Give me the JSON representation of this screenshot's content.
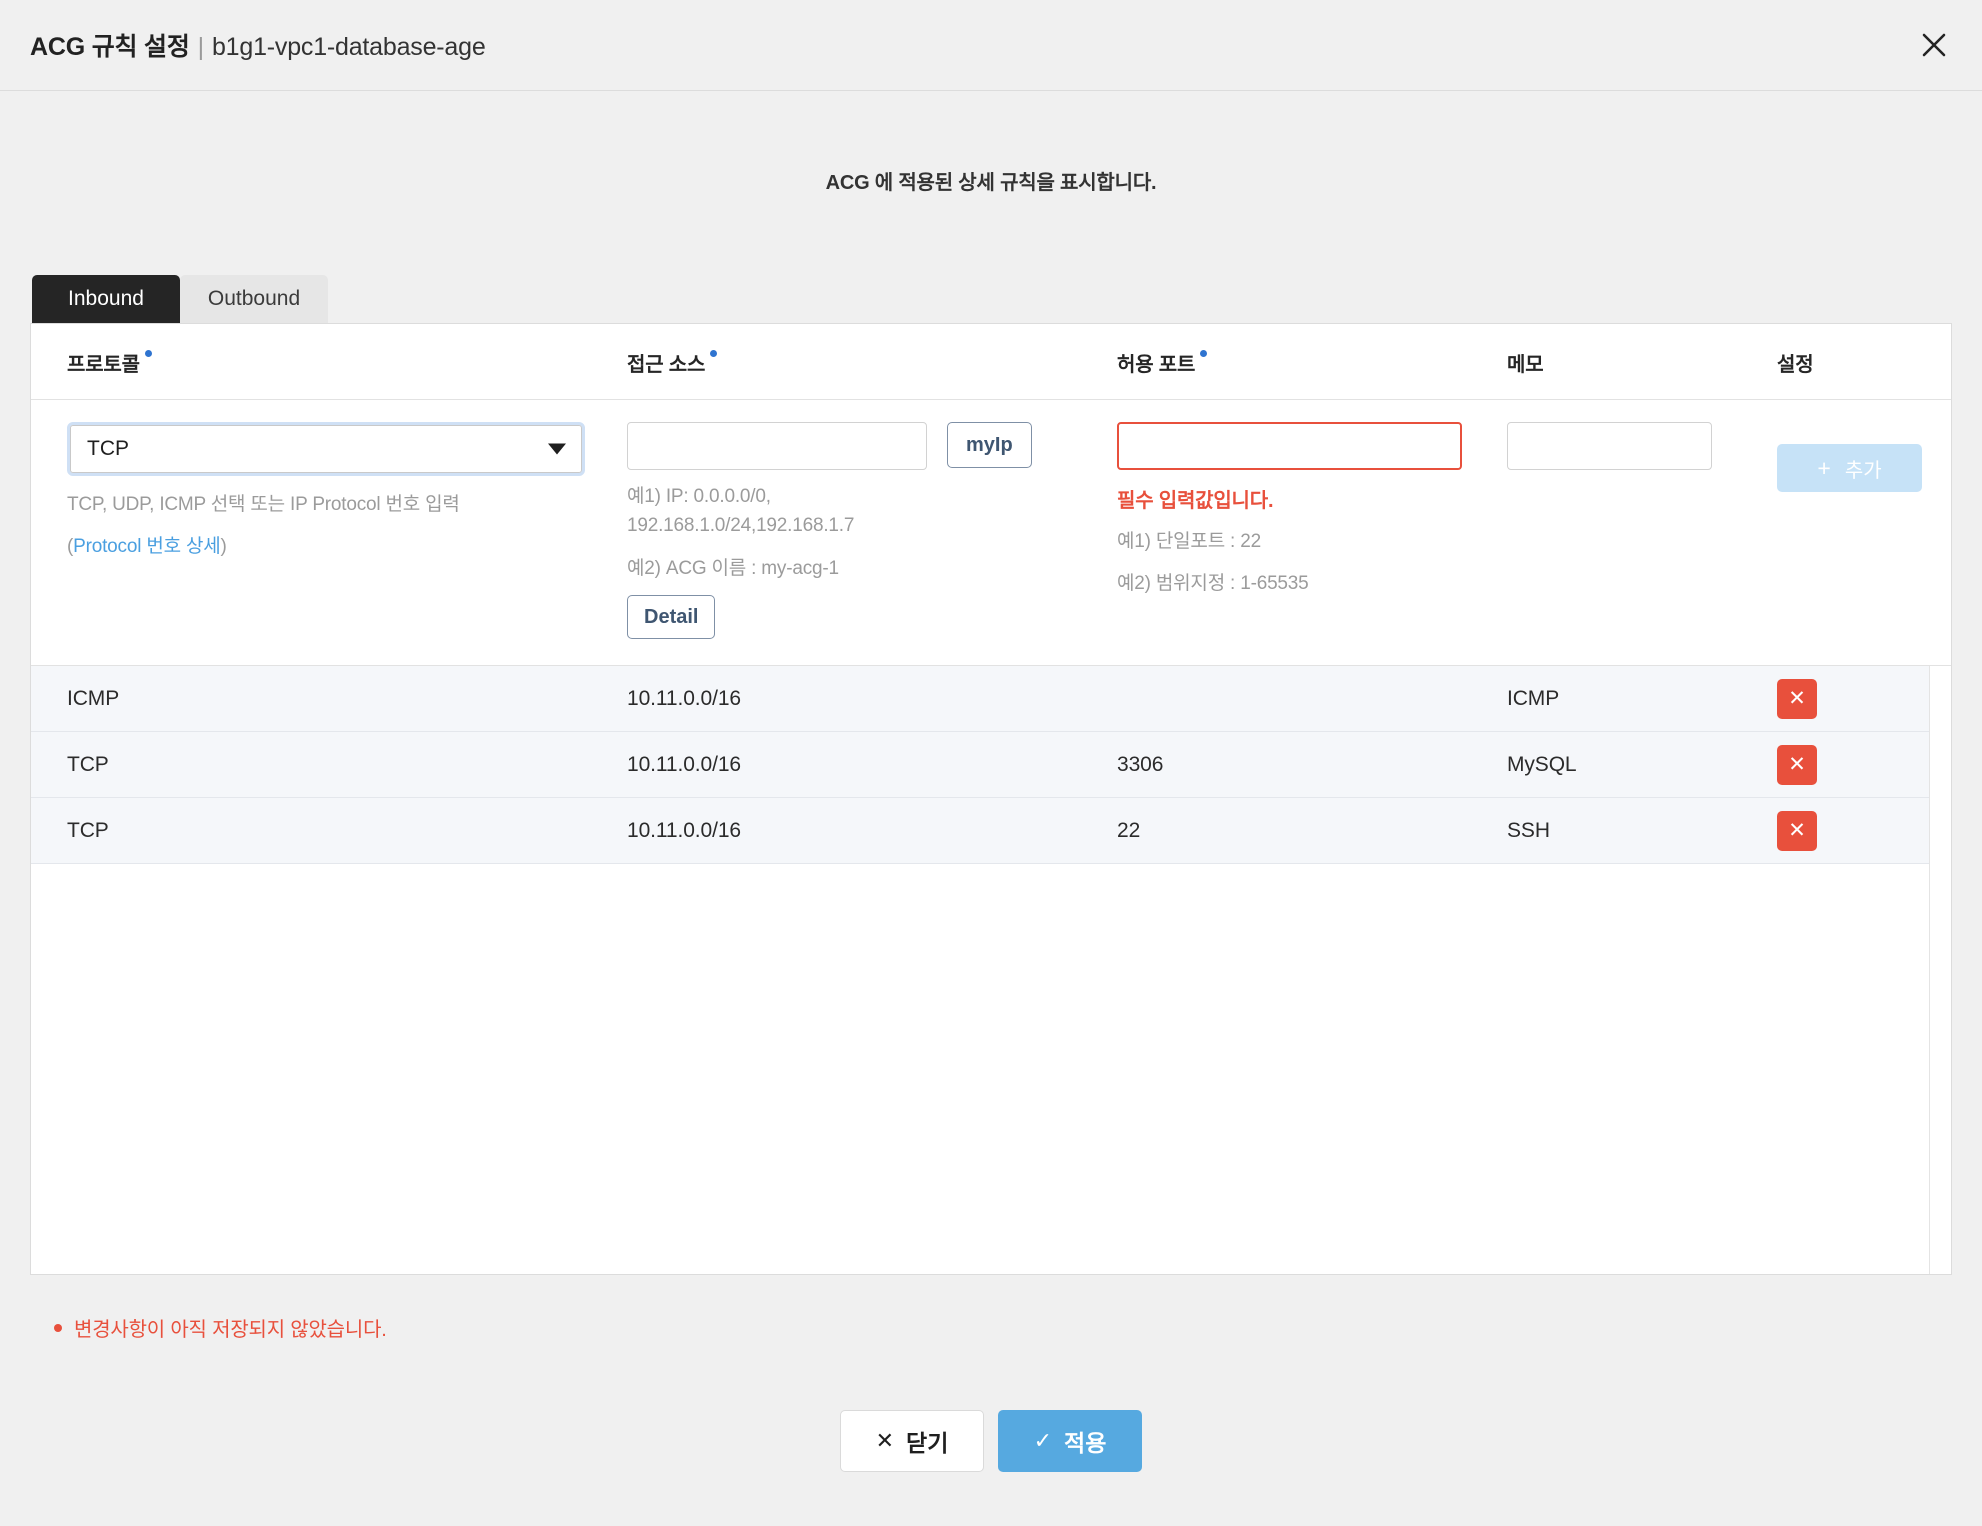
{
  "header": {
    "title_main": "ACG 규칙 설정",
    "title_separator": "|",
    "title_sub": "b1g1-vpc1-database-age",
    "close_icon": "close-icon"
  },
  "subtitle": "ACG 에 적용된 상세 규칙을 표시합니다.",
  "tabs": [
    {
      "label": "Inbound",
      "active": true
    },
    {
      "label": "Outbound",
      "active": false
    }
  ],
  "table": {
    "columns": [
      {
        "label": "프로토콜",
        "required": true
      },
      {
        "label": "접근 소스",
        "required": true
      },
      {
        "label": "허용 포트",
        "required": true
      },
      {
        "label": "메모",
        "required": false
      },
      {
        "label": "설정",
        "required": false
      }
    ],
    "entry_row": {
      "protocol": {
        "value": "TCP",
        "caret_icon": "chevron-down-icon",
        "hint_line1": "TCP, UDP, ICMP 선택 또는 IP Protocol 번호 입력",
        "hint_prefix": "(",
        "hint_link": "Protocol 번호 상세",
        "hint_suffix": ")"
      },
      "source": {
        "value": "",
        "placeholder": "",
        "myip_button": "myIp",
        "hint_line1": "예1) IP: 0.0.0.0/0,",
        "hint_line2": "192.168.1.0/24,192.168.1.7",
        "hint_line3": "예2) ACG 이름 : my-acg-1",
        "detail_button": "Detail"
      },
      "port": {
        "value": "",
        "placeholder": "",
        "error": "필수 입력값입니다.",
        "hint_line1": "예1) 단일포트 : 22",
        "hint_line2": "예2) 범위지정 : 1-65535"
      },
      "memo": {
        "value": "",
        "placeholder": ""
      },
      "add_button": {
        "label": "추가",
        "icon": "plus-icon",
        "disabled": true
      }
    },
    "rows": [
      {
        "protocol": "ICMP",
        "source": "10.11.0.0/16",
        "port": "",
        "memo": "ICMP",
        "delete_icon": "close-icon"
      },
      {
        "protocol": "TCP",
        "source": "10.11.0.0/16",
        "port": "3306",
        "memo": "MySQL",
        "delete_icon": "close-icon"
      },
      {
        "protocol": "TCP",
        "source": "10.11.0.0/16",
        "port": "22",
        "memo": "SSH",
        "delete_icon": "close-icon"
      }
    ]
  },
  "footer": {
    "warning": "변경사항이 아직 저장되지 않았습니다.",
    "close_button": "닫기",
    "close_icon_glyph": "✕",
    "apply_button": "적용",
    "apply_icon_glyph": "✓"
  },
  "colors": {
    "accent_blue": "#56a9e0",
    "danger": "#e8503c",
    "required_dot": "#2f74d0",
    "tab_active_bg": "#252525",
    "add_disabled_bg": "#c6e2f7",
    "slate_border": "#7f90a6",
    "page_bg": "#f0f0f0",
    "row_bg": "#f5f7fa"
  }
}
